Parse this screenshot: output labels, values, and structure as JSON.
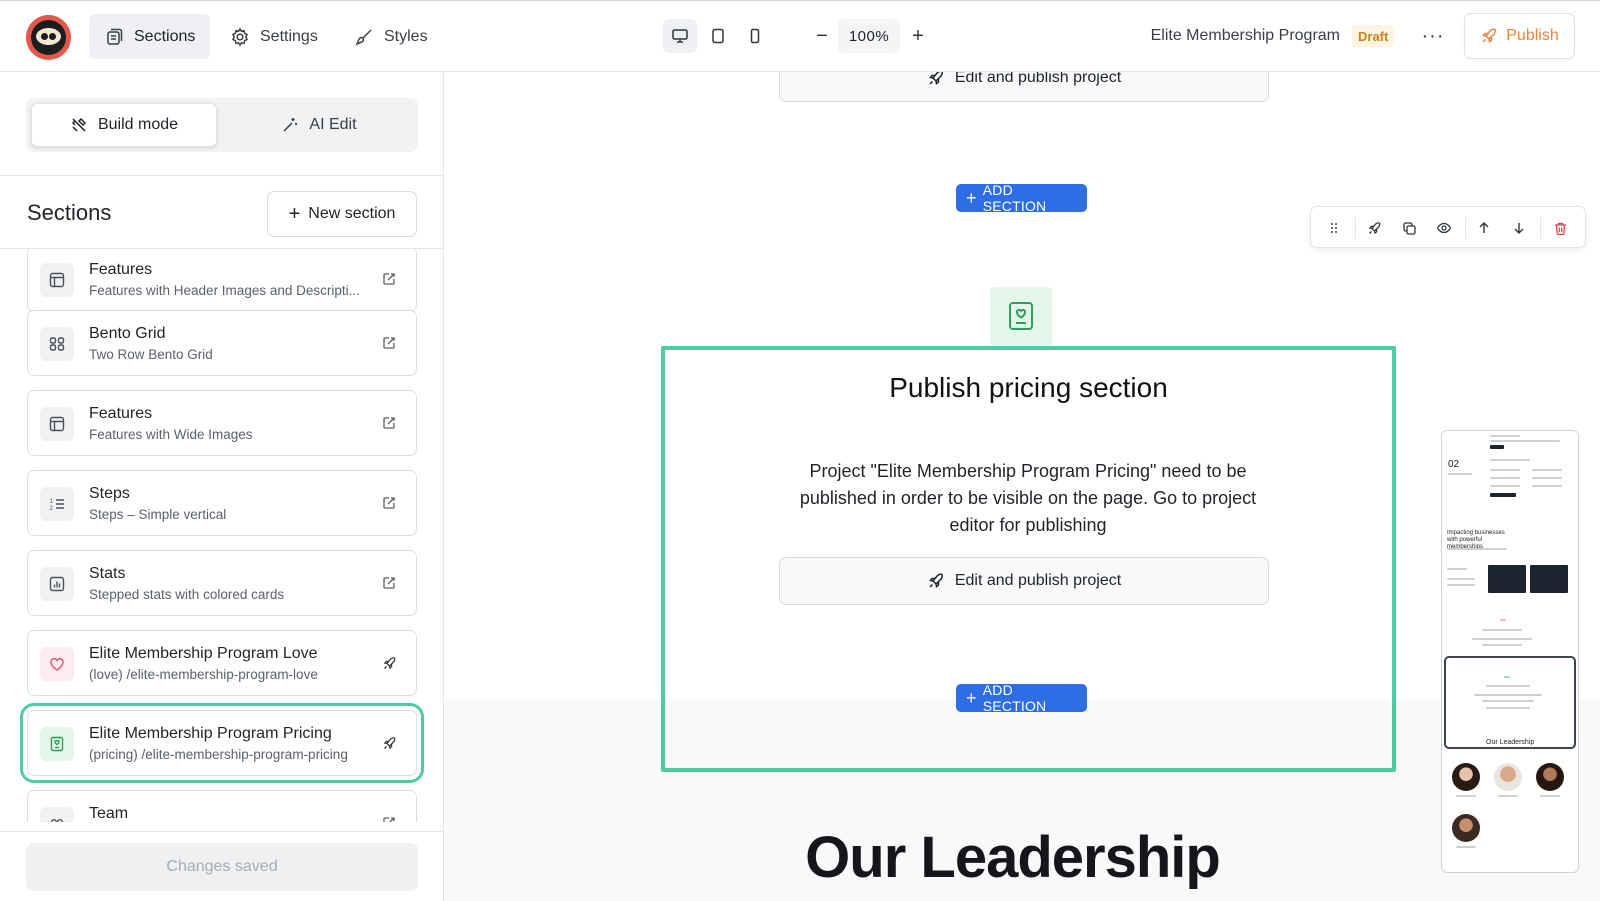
{
  "topbar": {
    "nav": [
      {
        "label": "Sections"
      },
      {
        "label": "Settings"
      },
      {
        "label": "Styles"
      }
    ],
    "zoom": "100%",
    "zoom_minus": "−",
    "zoom_plus": "+",
    "project_title": "Elite Membership Program",
    "status_badge": "Draft",
    "more": "···",
    "publish_label": "Publish"
  },
  "left_panel": {
    "modes": [
      {
        "label": "Build mode"
      },
      {
        "label": "AI Edit"
      }
    ],
    "sections_heading": "Sections",
    "new_section_label": "New section",
    "items": [
      {
        "title": "Features",
        "subtitle": "Features with Header Images and Descripti...",
        "icon": "layout-icon"
      },
      {
        "title": "Bento Grid",
        "subtitle": "Two Row Bento Grid",
        "icon": "grid-icon"
      },
      {
        "title": "Features",
        "subtitle": "Features with Wide Images",
        "icon": "layout-icon"
      },
      {
        "title": "Steps",
        "subtitle": "Steps – Simple vertical",
        "icon": "numbered-list-icon"
      },
      {
        "title": "Stats",
        "subtitle": "Stepped stats with colored cards",
        "icon": "bar-chart-icon"
      },
      {
        "title": "Elite Membership Program Love",
        "subtitle": "(love) /elite-membership-program-love",
        "icon": "heart-icon"
      },
      {
        "title": "Elite Membership Program Pricing",
        "subtitle": "(pricing) /elite-membership-program-pricing",
        "icon": "pricing-icon"
      },
      {
        "title": "Team",
        "subtitle": "",
        "icon": "team-icon"
      }
    ],
    "changes_saved": "Changes saved"
  },
  "canvas": {
    "edit_publish_label": "Edit and publish project",
    "add_section_label": "ADD SECTION",
    "pricing_heading": "Publish pricing section",
    "pricing_body": "Project \"Elite Membership Program Pricing\" need to be published in order to be visible on the page. Go to project editor for publishing",
    "leadership_heading": "Our Leadership"
  },
  "minimap": {
    "step_number": "02",
    "heading": "Impacting businesses with powerful memberships",
    "leadership": "Our Leadership"
  },
  "colors": {
    "accent_blue": "#2f6de4",
    "highlight_green": "#4ecba0",
    "publish_orange": "#e8843a",
    "draft_orange": "#c48516"
  }
}
